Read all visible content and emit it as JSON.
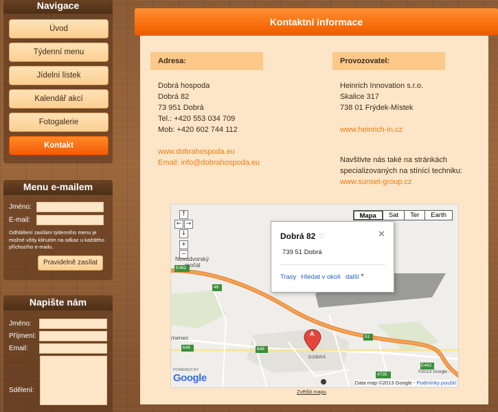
{
  "nav": {
    "title": "Navigace",
    "items": [
      {
        "label": "Úvod"
      },
      {
        "label": "Týdenní menu"
      },
      {
        "label": "Jídelní lístek"
      },
      {
        "label": "Kalendář akcí"
      },
      {
        "label": "Fotogalerie"
      },
      {
        "label": "Kontakt",
        "active": true
      }
    ]
  },
  "email_menu": {
    "title": "Menu e-mailem",
    "name_label": "Jméno:",
    "email_label": "E-mail:",
    "note": "Odhlášení zasílání týdenního menu je možné vždy klinutím na odkaz u každého příchozího e-mailu.",
    "submit_label": "Pravidelně zasílat"
  },
  "contact_form": {
    "title": "Napište nám",
    "name_label": "Jméno:",
    "surname_label": "Příjmení:",
    "email_label": "Email:",
    "message_label": "Sdělení:"
  },
  "main": {
    "title": "Kontaktní informace",
    "address": {
      "title": "Adresa:",
      "name": "Dobrá hospoda",
      "street": "Dobrá 82",
      "city": "73 951 Dobrá",
      "tel": "Tel.: +420 553 034 709",
      "mob": "Mob: +420 602 744 112",
      "web": "www.dobrahospoda.eu",
      "email": "Email: info@dobrahospoda.eu"
    },
    "operator": {
      "title": "Provozovatel:",
      "company": "Heinrich Innovation s.r.o.",
      "street": "Skalice 317",
      "city": "738 01 Frýdek-Místek",
      "web": "www.heinrich-in.cz",
      "visit_line1": "Navštivte nás také na stránkách",
      "visit_line2": "specializovaných na stínící techniku:",
      "visit_web": "www.sunset-group.cz"
    }
  },
  "map": {
    "types": [
      "Mapa",
      "Sat",
      "Ter",
      "Earth"
    ],
    "active_type": "Mapa",
    "bubble_title": "Dobrá 82",
    "bubble_address": "739 51 Dobrá",
    "bubble_links": [
      "Trasy",
      "Hledat v okolí",
      "další"
    ],
    "marker_letter": "A",
    "labels": {
      "place": "Novodvorský",
      "place2": "močál",
      "road1": "E462",
      "road2": "48",
      "road3": "51",
      "road4": "648",
      "road5": "648",
      "road6": "E462",
      "road7": "4735",
      "village": "DOBRÁ",
      "village2": "menec"
    },
    "powered_by": "POWERED BY",
    "google": "Google",
    "copyright": "©2013 Google -",
    "attribution": "Data map ©2013 Google -",
    "terms": "Podmínky použití",
    "enlarge": "Zvětšit mapu"
  }
}
